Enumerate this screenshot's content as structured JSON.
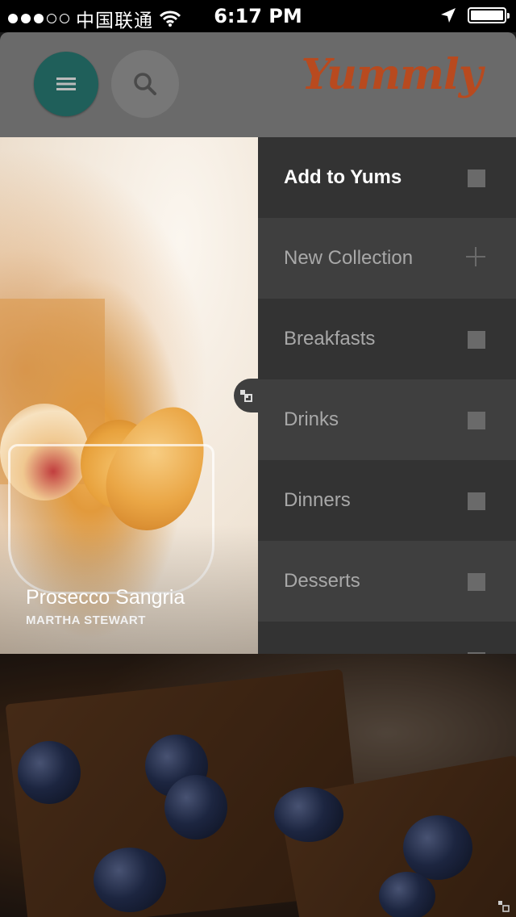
{
  "status_bar": {
    "carrier": "中国联通",
    "time": "6:17 PM",
    "signal_dots_filled": 3,
    "signal_dots_total": 5,
    "battery_level": 1.0
  },
  "header": {
    "logo_text": "Yummly",
    "logo_tm": "™",
    "menu_icon": "hamburger-icon",
    "search_icon": "search-icon",
    "brand_color": "#b84a1f",
    "menu_button_color": "#1f5f5a"
  },
  "recipe": {
    "title": "Prosecco Sangria",
    "source": "MARTHA STEWART"
  },
  "yum_panel": {
    "header_label": "Add to Yums",
    "new_collection_label": "New Collection",
    "collections": [
      {
        "label": "Breakfasts"
      },
      {
        "label": "Drinks"
      },
      {
        "label": "Dinners"
      },
      {
        "label": "Desserts"
      }
    ]
  }
}
